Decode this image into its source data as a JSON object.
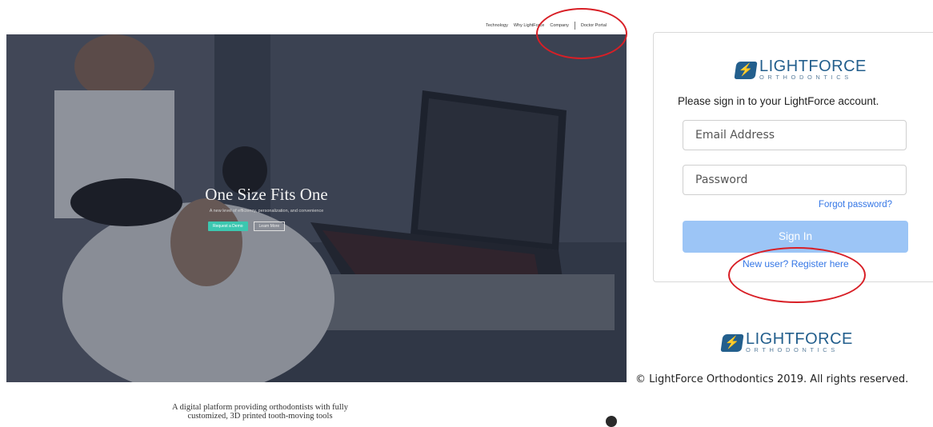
{
  "site": {
    "nav": {
      "items": [
        "Technology",
        "Why LightForce",
        "Company",
        "Doctor Portal"
      ]
    },
    "hero": {
      "title": "One Size Fits One",
      "subtitle": "A new level of efficiency, personalization, and convenience",
      "demo_button": "Request a Demo",
      "learn_button": "Learn More"
    },
    "tagline_line1": "A digital platform providing orthodontists with fully",
    "tagline_line2": "customized, 3D printed tooth-moving tools"
  },
  "login": {
    "logo": {
      "brand": "LIGHTFORCE",
      "sub": "ORTHODONTICS",
      "icon": "lightning-bolt-icon"
    },
    "prompt": "Please sign in to your LightForce account.",
    "email_placeholder": "Email Address",
    "password_placeholder": "Password",
    "forgot": "Forgot password?",
    "signin": "Sign In",
    "register": "New user? Register here"
  },
  "footer": {
    "logo": {
      "brand": "LIGHTFORCE",
      "sub": "ORTHODONTICS",
      "icon": "lightning-bolt-icon"
    },
    "copyright": "© LightForce Orthodontics 2019. All rights reserved."
  },
  "colors": {
    "brand": "#235f8d",
    "link": "#3577e6",
    "signin_button": "#9cc5f6",
    "demo_button": "#3cc7b0",
    "annotation": "#d81f26"
  }
}
